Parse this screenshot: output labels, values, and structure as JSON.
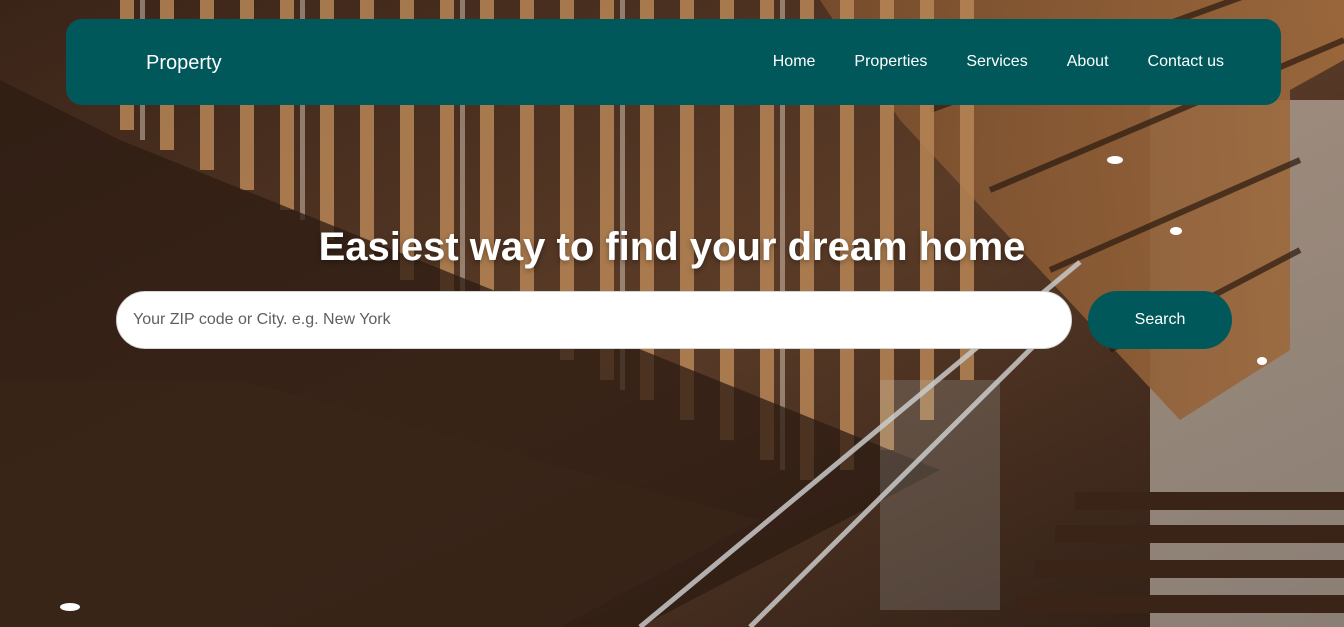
{
  "brand": "Property",
  "nav": {
    "items": [
      {
        "label": "Home"
      },
      {
        "label": "Properties"
      },
      {
        "label": "Services"
      },
      {
        "label": "About"
      },
      {
        "label": "Contact us"
      }
    ]
  },
  "hero": {
    "headline": "Easiest way to find your dream home",
    "search": {
      "placeholder": "Your ZIP code or City. e.g. New York",
      "value": "",
      "button_label": "Search"
    }
  },
  "colors": {
    "primary": "#01585a",
    "text_light": "#ffffff"
  }
}
